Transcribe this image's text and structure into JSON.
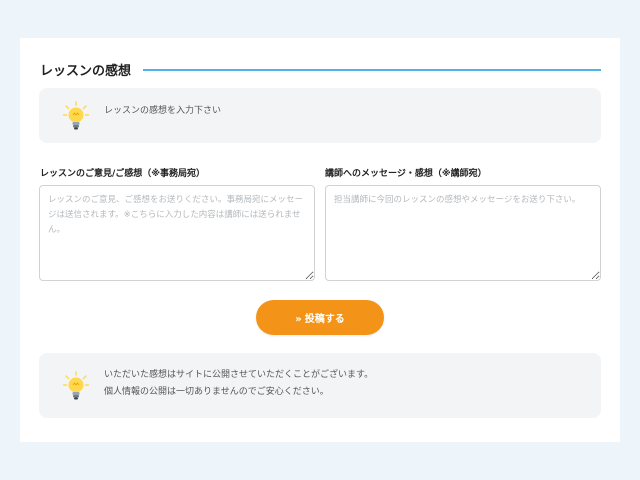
{
  "theme": {
    "accent_line": "#4fb3e8",
    "button_color": "#f39418",
    "bulb_glow": "#ffd84d"
  },
  "section": {
    "title": "レッスンの感想"
  },
  "intro": {
    "icon": "lightbulb-icon",
    "text": "レッスンの感想を入力下さい"
  },
  "form": {
    "office_feedback": {
      "label": "レッスンのご意見/ご感想（※事務局宛）",
      "placeholder": "レッスンのご意見、ご感想をお送りください。事務局宛にメッセージは送信されます。※こちらに入力した内容は講師には送られません。",
      "value": ""
    },
    "teacher_message": {
      "label": "講師へのメッセージ・感想（※講師宛）",
      "placeholder": "担当講師に今回のレッスンの感想やメッセージをお送り下さい。",
      "value": ""
    },
    "submit": {
      "chevron": "»",
      "label": "投稿する"
    }
  },
  "notice": {
    "icon": "lightbulb-icon",
    "lines": [
      "いただいた感想はサイトに公開させていただくことがございます。",
      "個人情報の公開は一切ありませんのでご安心ください。"
    ]
  }
}
